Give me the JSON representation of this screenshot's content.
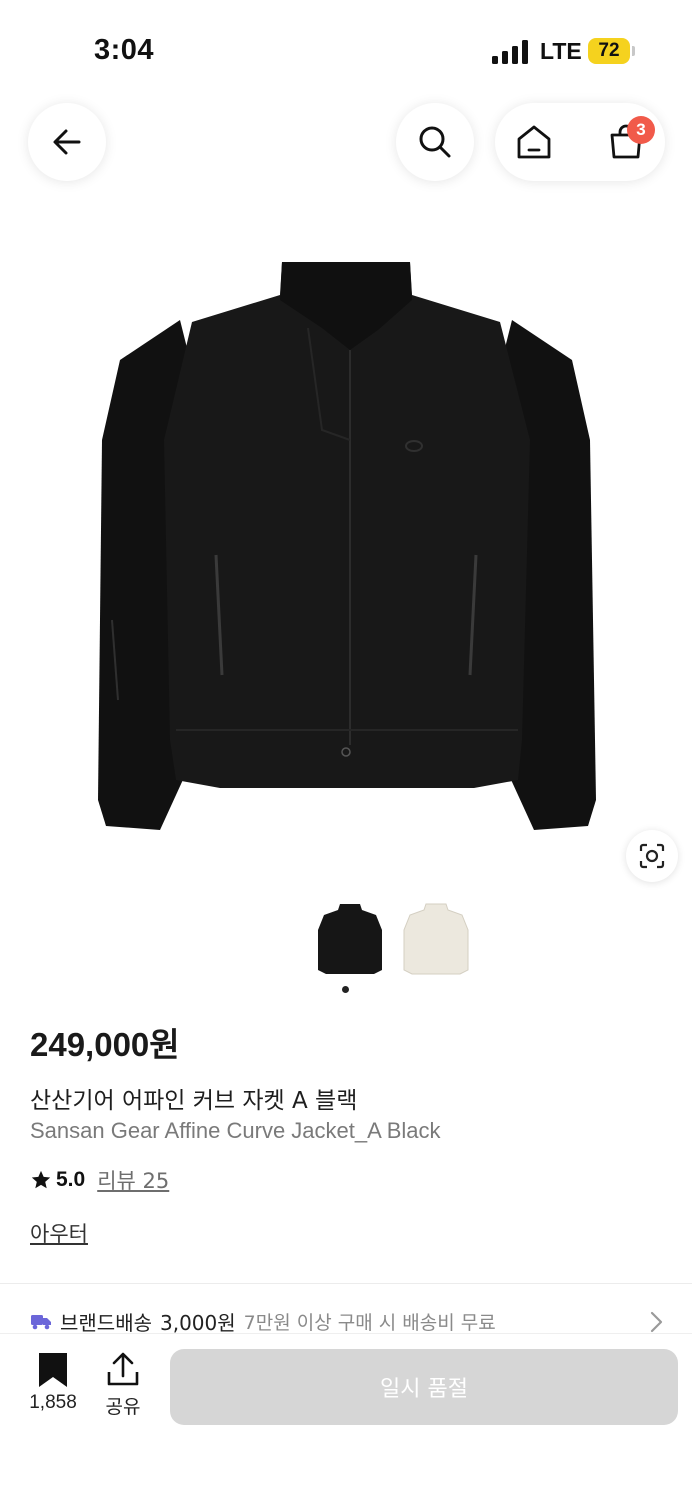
{
  "status_bar": {
    "time": "3:04",
    "network": "LTE",
    "battery": "72"
  },
  "nav": {
    "back_icon": "arrow-left-icon",
    "search_icon": "search-icon",
    "home_icon": "home-icon",
    "cart_icon": "shopping-bag-icon",
    "cart_count": "3"
  },
  "product": {
    "image": "black-jacket",
    "thumbnails": [
      "black",
      "ivory"
    ],
    "selected_thumbnail": 0,
    "price": "249,000원",
    "name_ko": "산산기어 어파인 커브 자켓 A 블랙",
    "name_en": "Sansan Gear Affine Curve Jacket_A Black",
    "rating": "5.0",
    "review_label": "리뷰 25",
    "category": "아우터"
  },
  "shipping": {
    "icon": "truck-icon",
    "brand_label": "브랜드배송",
    "fee": "3,000원",
    "note": "7만원 이상 구매 시 배송비 무료"
  },
  "bottom_bar": {
    "bookmark_count": "1,858",
    "share_label": "공유",
    "buy_button": "일시 품절"
  },
  "colors": {
    "accent_badge": "#f15a4a",
    "battery": "#f5d21e",
    "disabled_button": "#d6d6d6",
    "shipping_icon": "#6b66d9"
  }
}
